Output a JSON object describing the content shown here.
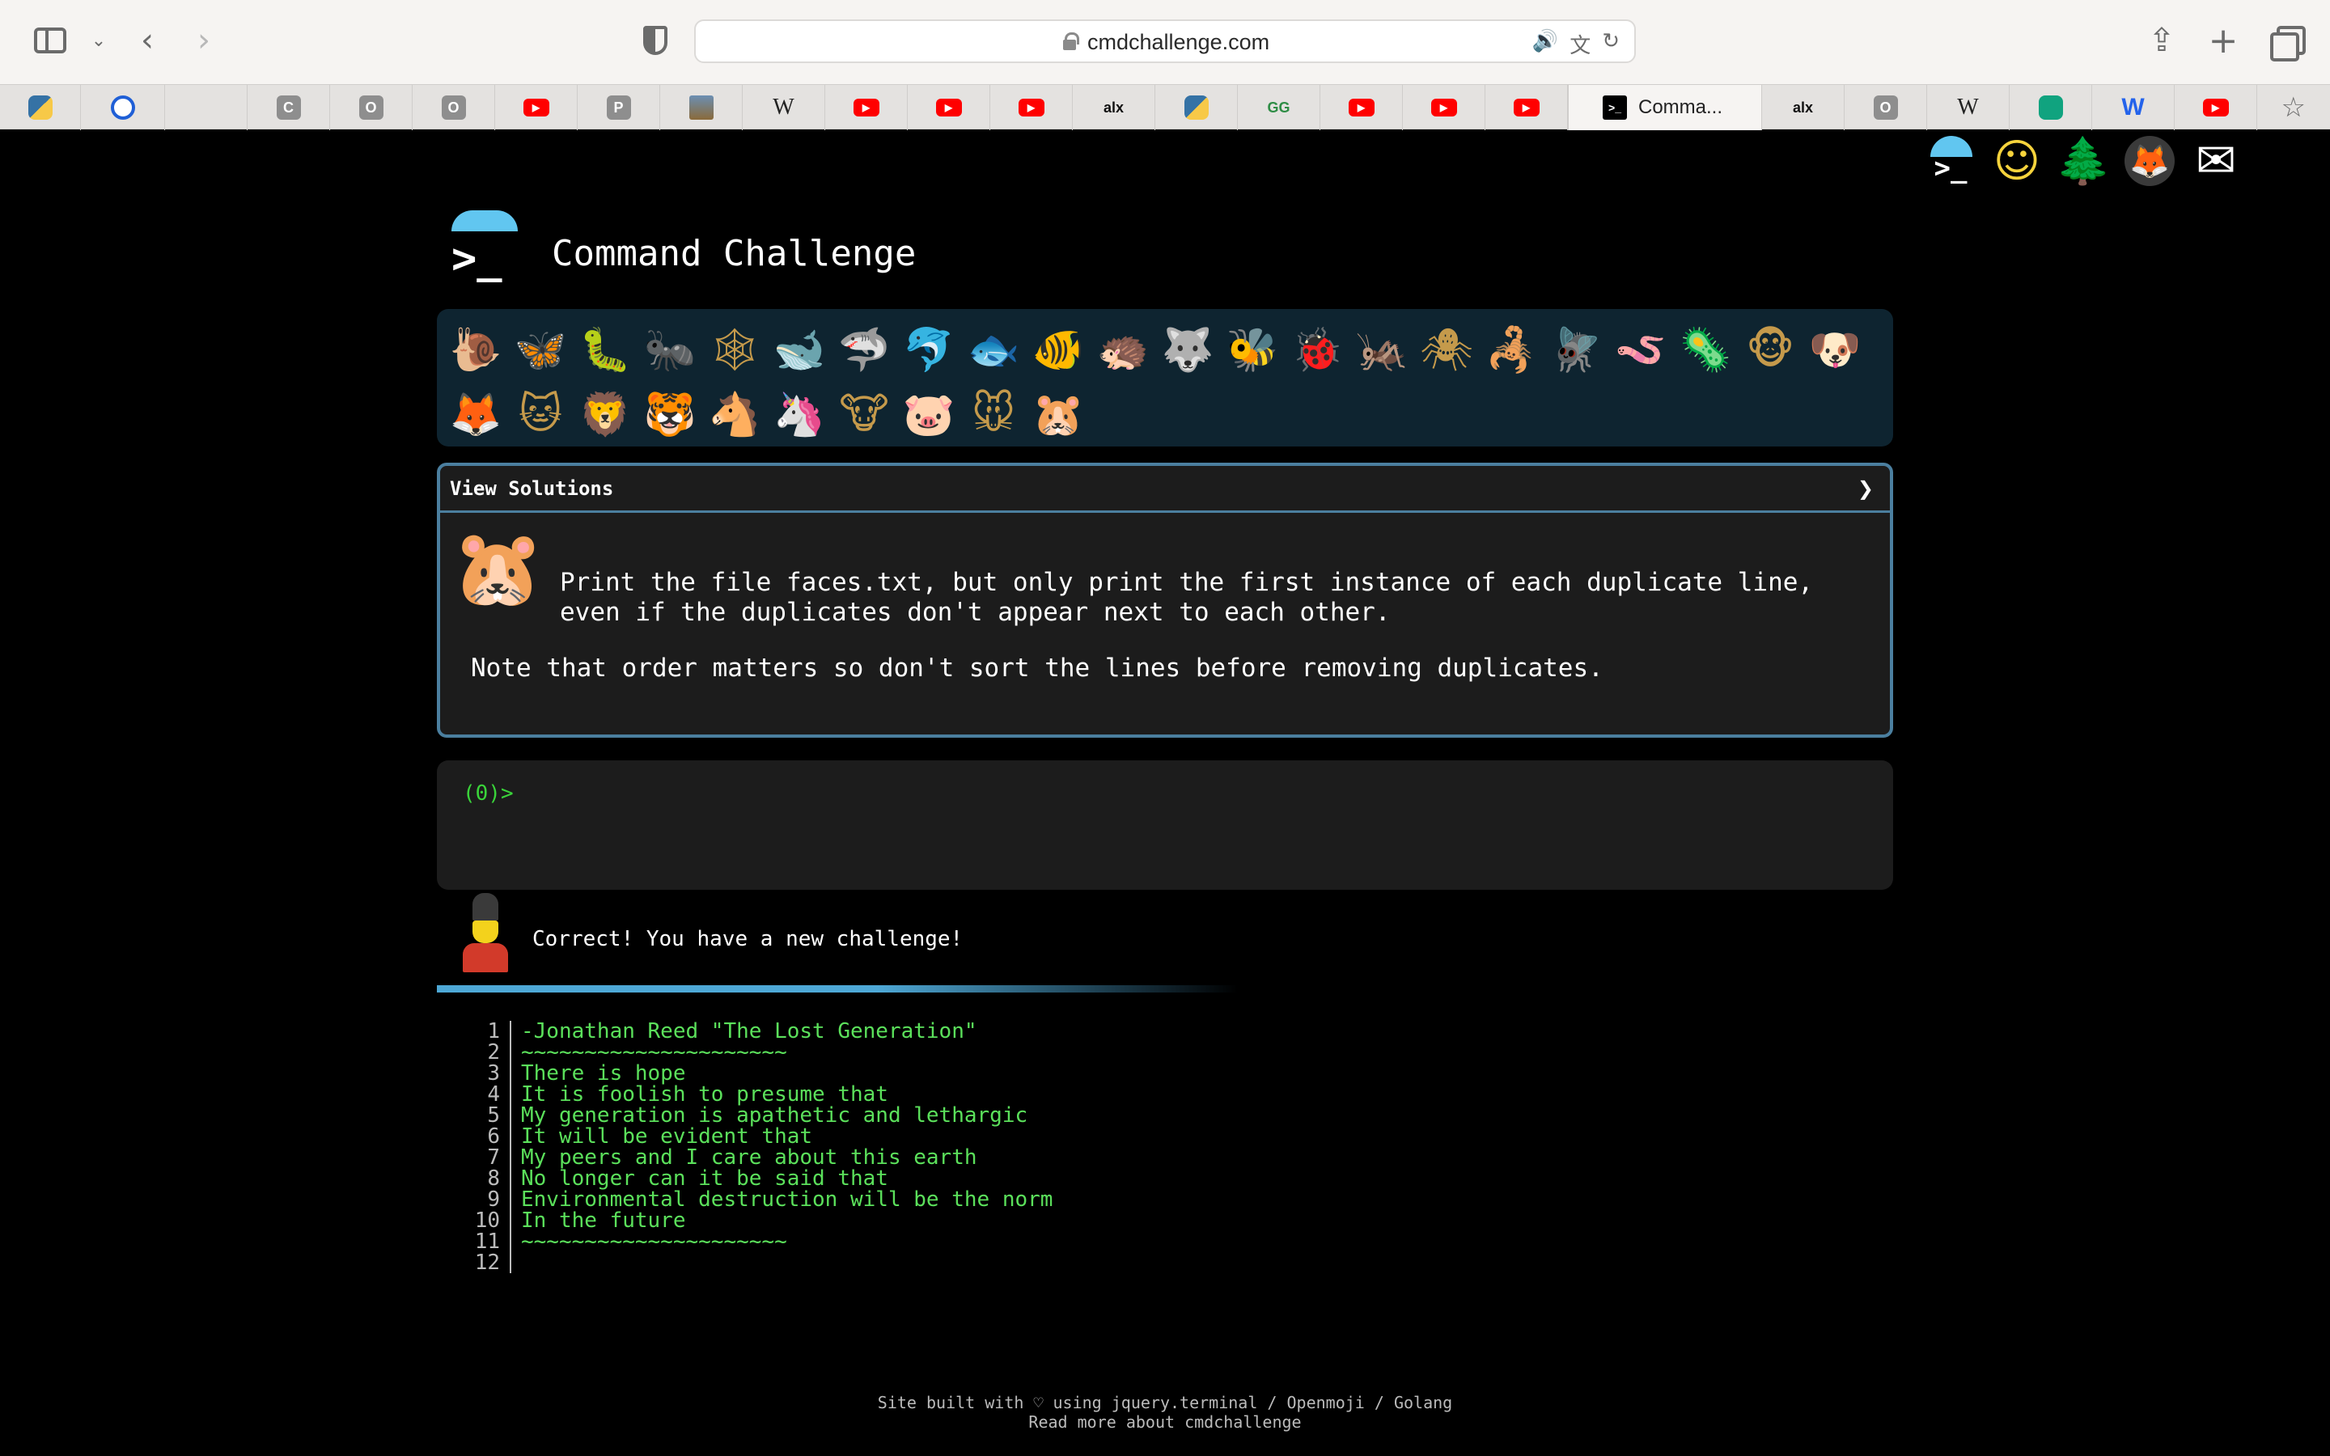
{
  "browser": {
    "url": "cmdchallenge.com",
    "active_tab_title": "Comma...",
    "tabs": [
      {
        "icon": "python-icon",
        "label": ""
      },
      {
        "icon": "power-icon",
        "label": ""
      },
      {
        "icon": "stackoverflow-icon",
        "label": ""
      },
      {
        "icon": "c-icon",
        "label": "C"
      },
      {
        "icon": "o-icon",
        "label": "O"
      },
      {
        "icon": "o-icon",
        "label": "O"
      },
      {
        "icon": "youtube-icon",
        "label": "▶"
      },
      {
        "icon": "p-icon",
        "label": "P"
      },
      {
        "icon": "image-icon",
        "label": ""
      },
      {
        "icon": "wikipedia-icon",
        "label": "W"
      },
      {
        "icon": "youtube-icon",
        "label": "▶"
      },
      {
        "icon": "youtube-icon",
        "label": "▶"
      },
      {
        "icon": "youtube-icon",
        "label": "▶"
      },
      {
        "icon": "alx-icon",
        "label": "alx"
      },
      {
        "icon": "python-icon",
        "label": ""
      },
      {
        "icon": "geeksforgeeks-icon",
        "label": "GG"
      },
      {
        "icon": "youtube-icon",
        "label": "▶"
      },
      {
        "icon": "youtube-icon",
        "label": "▶"
      },
      {
        "icon": "youtube-icon",
        "label": "▶"
      },
      {
        "icon": "terminal-icon",
        "label": ">_"
      },
      {
        "icon": "alx-icon",
        "label": "alx"
      },
      {
        "icon": "o-icon",
        "label": "O"
      },
      {
        "icon": "wikipedia-icon",
        "label": "W"
      },
      {
        "icon": "chatgpt-icon",
        "label": ""
      },
      {
        "icon": "wordle-icon",
        "label": "W"
      },
      {
        "icon": "youtube-icon",
        "label": "▶"
      }
    ]
  },
  "header": {
    "title": "Command Challenge",
    "logo_glyph": ">_",
    "top_icons": [
      "terminal-icon",
      "face-hand-icon",
      "tree-icon",
      "gitlab-icon",
      "mail-icon"
    ]
  },
  "animals": [
    {
      "name": "snail",
      "glyph": "🐌"
    },
    {
      "name": "butterfly",
      "glyph": "🦋"
    },
    {
      "name": "bug",
      "glyph": "🐛"
    },
    {
      "name": "ant",
      "glyph": "🐜"
    },
    {
      "name": "spider-web",
      "glyph": "🕸"
    },
    {
      "name": "whale",
      "glyph": "🐋"
    },
    {
      "name": "shark",
      "glyph": "🦈"
    },
    {
      "name": "dolphin",
      "glyph": "🐬"
    },
    {
      "name": "fish",
      "glyph": "🐟"
    },
    {
      "name": "tropical-fish",
      "glyph": "🐠"
    },
    {
      "name": "hedgehog",
      "glyph": "🦔"
    },
    {
      "name": "wolf",
      "glyph": "🐺"
    },
    {
      "name": "bee",
      "glyph": "🐝"
    },
    {
      "name": "ladybug",
      "glyph": "🐞"
    },
    {
      "name": "cricket",
      "glyph": "🦗"
    },
    {
      "name": "spider",
      "glyph": "🕷"
    },
    {
      "name": "scorpion",
      "glyph": "🦂"
    },
    {
      "name": "fly",
      "glyph": "🪰"
    },
    {
      "name": "worm",
      "glyph": "🪱"
    },
    {
      "name": "microbe",
      "glyph": "🦠"
    },
    {
      "name": "monkey",
      "glyph": "🐵"
    },
    {
      "name": "dog",
      "glyph": "🐶"
    },
    {
      "name": "fox",
      "glyph": "🦊"
    },
    {
      "name": "cat",
      "glyph": "🐱"
    },
    {
      "name": "lion",
      "glyph": "🦁"
    },
    {
      "name": "tiger",
      "glyph": "🐯"
    },
    {
      "name": "horse",
      "glyph": "🐴"
    },
    {
      "name": "unicorn",
      "glyph": "🦄"
    },
    {
      "name": "cow",
      "glyph": "🐮"
    },
    {
      "name": "pig",
      "glyph": "🐷"
    },
    {
      "name": "mouse",
      "glyph": "🐭"
    },
    {
      "name": "hamster",
      "glyph": "🐹"
    }
  ],
  "challenge": {
    "header_label": "View Solutions",
    "chevron": "❯",
    "avatar_glyph": "🐹",
    "description": "Print the file faces.txt, but only print the first instance of each duplicate line, even if the duplicates don't appear next to each other.",
    "note": "Note that order matters so don't sort the lines before removing duplicates."
  },
  "terminal": {
    "prompt": "(0)>"
  },
  "result": {
    "message": "Correct! You have a new challenge!",
    "progress_fraction": 0.55
  },
  "output": {
    "lines": [
      {
        "n": "1",
        "text": "-Jonathan Reed \"The Lost Generation\""
      },
      {
        "n": "2",
        "text": "~~~~~~~~~~~~~~~~~~~~~"
      },
      {
        "n": "3",
        "text": "There is hope"
      },
      {
        "n": "4",
        "text": "It is foolish to presume that"
      },
      {
        "n": "5",
        "text": "My generation is apathetic and lethargic"
      },
      {
        "n": "6",
        "text": "It will be evident that"
      },
      {
        "n": "7",
        "text": "My peers and I care about this earth"
      },
      {
        "n": "8",
        "text": "No longer can it be said that"
      },
      {
        "n": "9",
        "text": "Environmental destruction will be the norm"
      },
      {
        "n": "10",
        "text": "In the future"
      },
      {
        "n": "11",
        "text": "~~~~~~~~~~~~~~~~~~~~~"
      },
      {
        "n": "12",
        "text": ""
      }
    ]
  },
  "footer": {
    "line1": "Site built with ♡ using jquery.terminal / Openmoji / Golang",
    "line2": "Read more about cmdchallenge"
  }
}
